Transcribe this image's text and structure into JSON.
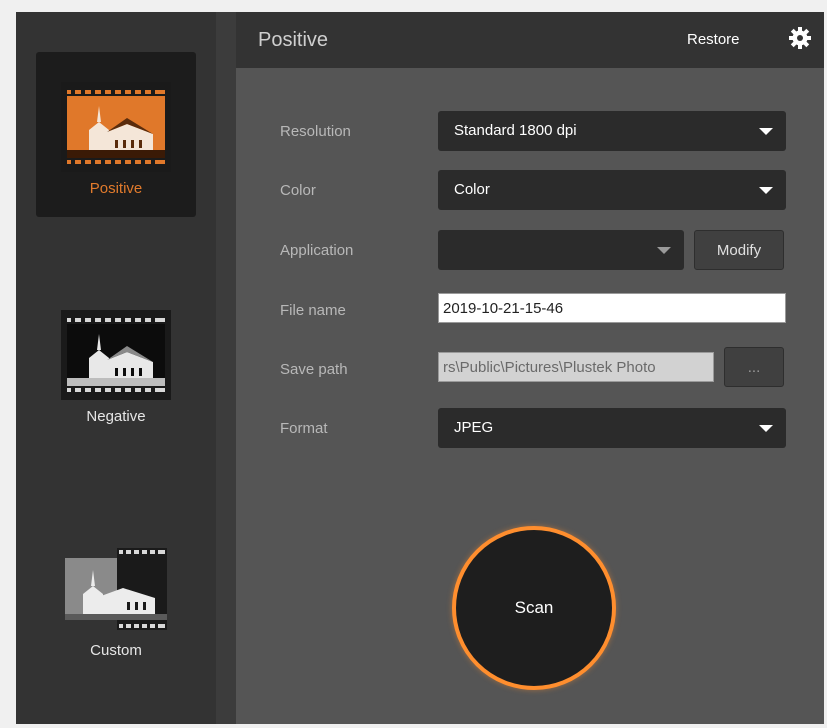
{
  "sidebar": {
    "modes": [
      {
        "label": "Positive",
        "icon": "positive-film-icon",
        "active": true
      },
      {
        "label": "Negative",
        "icon": "negative-film-icon",
        "active": false
      },
      {
        "label": "Custom",
        "icon": "custom-film-icon",
        "active": false
      }
    ]
  },
  "header": {
    "title": "Positive",
    "restore_label": "Restore",
    "settings_icon": "gear-icon"
  },
  "form": {
    "resolution": {
      "label": "Resolution",
      "value": "Standard 1800 dpi"
    },
    "color": {
      "label": "Color",
      "value": "Color"
    },
    "application": {
      "label": "Application",
      "value": "",
      "modify_label": "Modify"
    },
    "file_name": {
      "label": "File name",
      "value": "2019-10-21-15-46"
    },
    "save_path": {
      "label": "Save path",
      "value": "rs\\Public\\Pictures\\Plustek Photo",
      "browse_label": "..."
    },
    "format": {
      "label": "Format",
      "value": "JPEG"
    }
  },
  "scan": {
    "label": "Scan"
  },
  "colors": {
    "accent": "#ff8e2e",
    "active_label": "#e07a2c",
    "panel": "#555555",
    "sidebar": "#333333"
  }
}
